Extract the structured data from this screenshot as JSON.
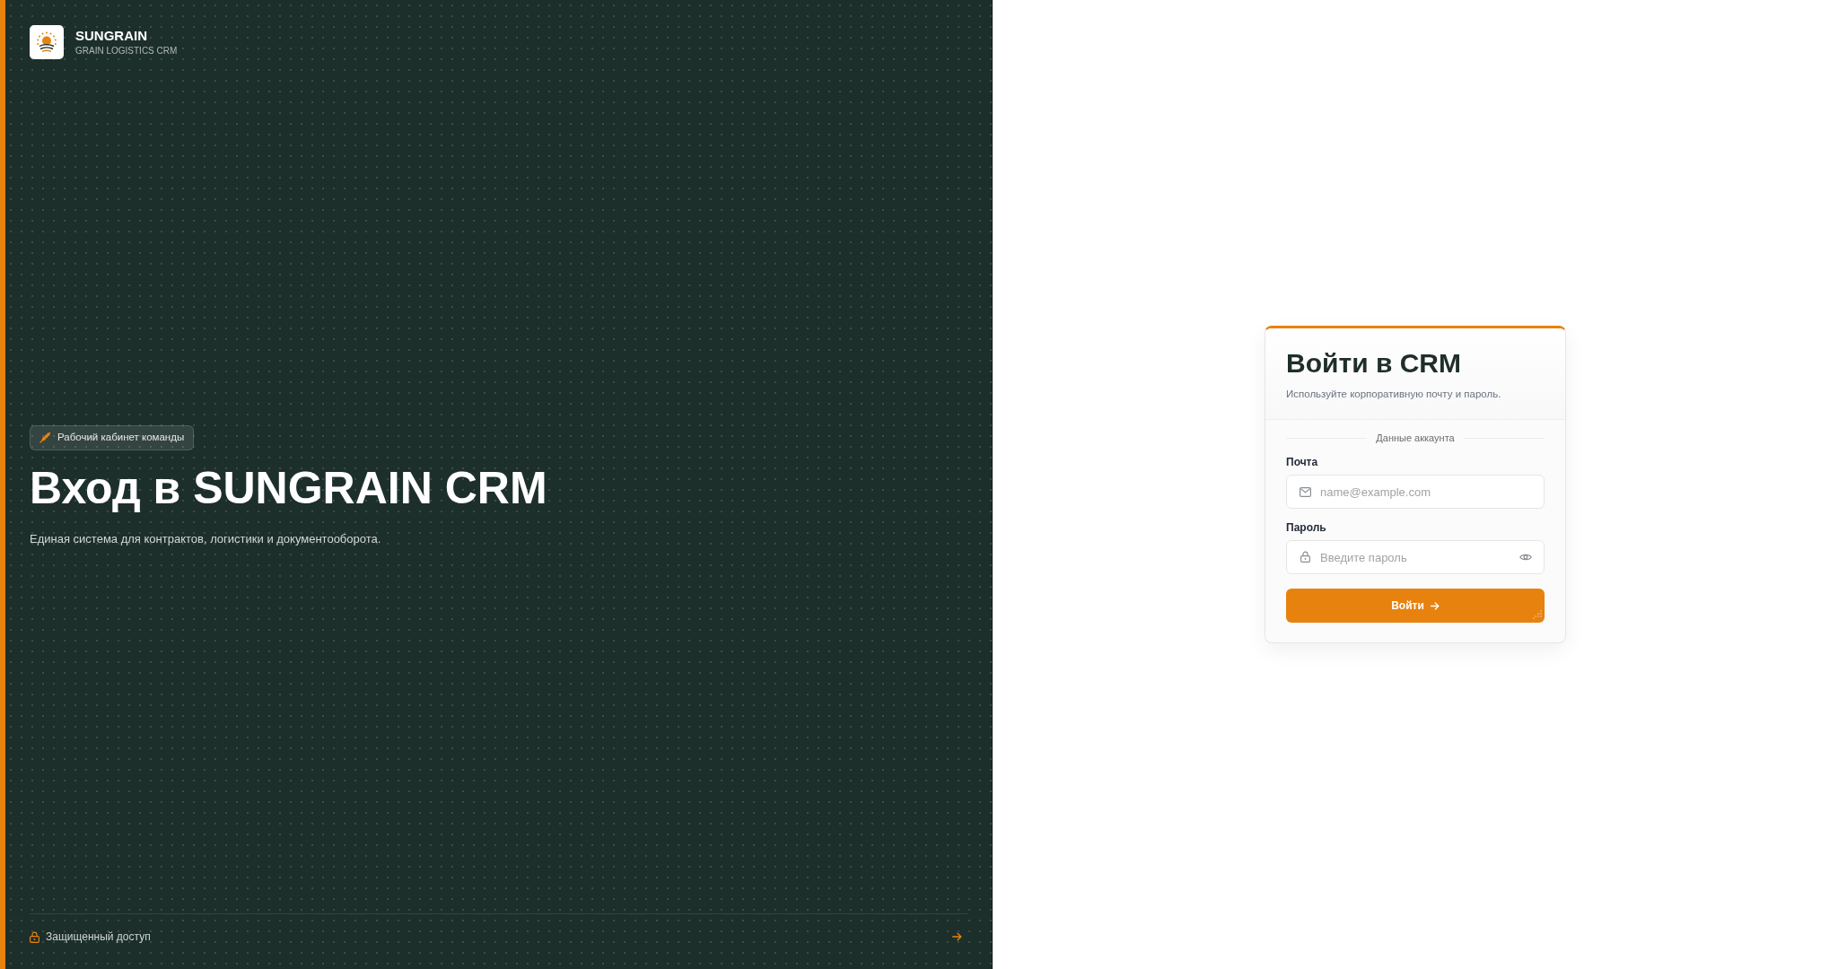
{
  "brand": {
    "name": "SUNGRAIN",
    "tagline": "GRAIN LOGISTICS CRM"
  },
  "hero": {
    "badge": "Рабочий кабинет команды",
    "title": "Вход в SUNGRAIN CRM",
    "subtitle": "Единая система для контрактов, логистики и документооборота."
  },
  "footer": {
    "label": "Защищенный доступ"
  },
  "login_card": {
    "title": "Войти в CRM",
    "subtitle": "Используйте корпоративную почту и пароль.",
    "section_label": "Данные аккаунта",
    "fields": [
      {
        "kind": "email",
        "label": "Почта",
        "placeholder": "name@example.com"
      },
      {
        "kind": "password",
        "label": "Пароль",
        "placeholder": "Введите пароль"
      }
    ],
    "submit_button": {
      "label": "Войти"
    }
  }
}
